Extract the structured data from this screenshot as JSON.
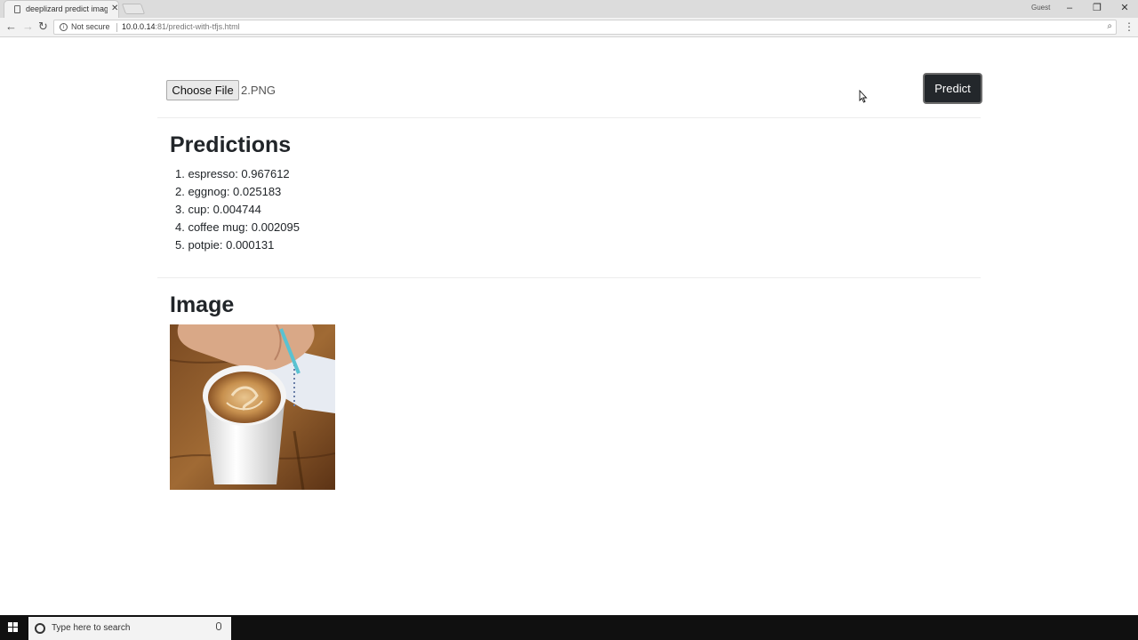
{
  "browser": {
    "tab_title": "deeplizard predict image",
    "profile_label": "Guest",
    "security_label": "Not secure",
    "url_host": "10.0.0.14",
    "url_rest": ":81/predict-with-tfjs.html"
  },
  "upload": {
    "choose_file_label": "Choose File",
    "file_name": "2.PNG",
    "predict_label": "Predict"
  },
  "predictions": {
    "title": "Predictions",
    "items": [
      "1. espresso: 0.967612",
      "2. eggnog: 0.025183",
      "3. cup: 0.004744",
      "4. coffee mug: 0.002095",
      "5. potpie: 0.000131"
    ]
  },
  "image_section": {
    "title": "Image"
  },
  "taskbar": {
    "search_placeholder": "Type here to search"
  },
  "colors": {
    "predict_button_bg": "#23272b",
    "heading_text": "#212529"
  }
}
